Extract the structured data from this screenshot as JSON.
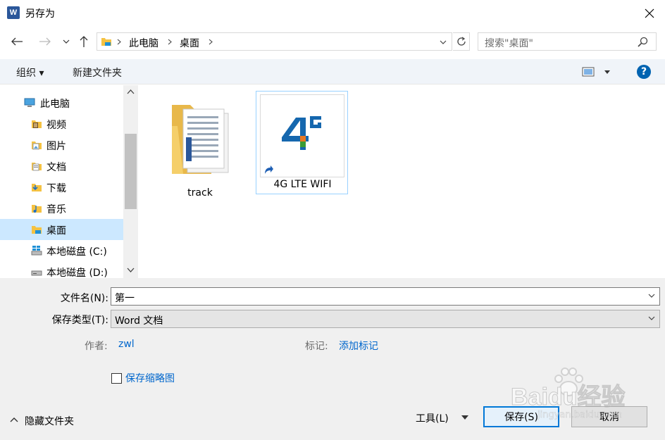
{
  "window": {
    "title": "另存为",
    "app_icon_letter": "W"
  },
  "address": {
    "crumbs": [
      "此电脑",
      "桌面"
    ],
    "search_placeholder": "搜索\"桌面\""
  },
  "toolbar": {
    "organize": "组织 ▾",
    "new_folder": "新建文件夹",
    "help": "?"
  },
  "nav": {
    "items": [
      {
        "label": "此电脑",
        "icon": "computer-icon"
      },
      {
        "label": "视频",
        "icon": "videos-folder-icon"
      },
      {
        "label": "图片",
        "icon": "pictures-folder-icon"
      },
      {
        "label": "文档",
        "icon": "documents-folder-icon"
      },
      {
        "label": "下载",
        "icon": "downloads-folder-icon"
      },
      {
        "label": "音乐",
        "icon": "music-folder-icon"
      },
      {
        "label": "桌面",
        "icon": "desktop-folder-icon",
        "selected": true
      },
      {
        "label": "本地磁盘 (C:)",
        "icon": "windows-drive-icon"
      },
      {
        "label": "本地磁盘 (D:)",
        "icon": "drive-icon"
      }
    ]
  },
  "files": [
    {
      "name": "track",
      "type": "folder"
    },
    {
      "name": "4G LTE WIFI",
      "type": "shortcut",
      "logo_text": "4G",
      "selected": true
    }
  ],
  "form": {
    "filename_label": "文件名(N):",
    "filename_value": "第一",
    "filetype_label": "保存类型(T):",
    "filetype_value": "Word 文档",
    "author_label": "作者:",
    "author_value": "zwl",
    "tags_label": "标记:",
    "tags_value": "添加标记",
    "thumbnail_label": "保存缩略图",
    "thumbnail_checked": false
  },
  "footer": {
    "hide_folders": "隐藏文件夹",
    "tools": "工具(L)",
    "save": "保存(S)",
    "cancel": "取消"
  },
  "watermark": {
    "text": "Baidu经验",
    "sub": "jingyan.baidu.com"
  },
  "colors": {
    "accent": "#0078d7",
    "selected_bg": "#cce8ff",
    "link": "#0066cc",
    "word_blue": "#2b579a"
  }
}
